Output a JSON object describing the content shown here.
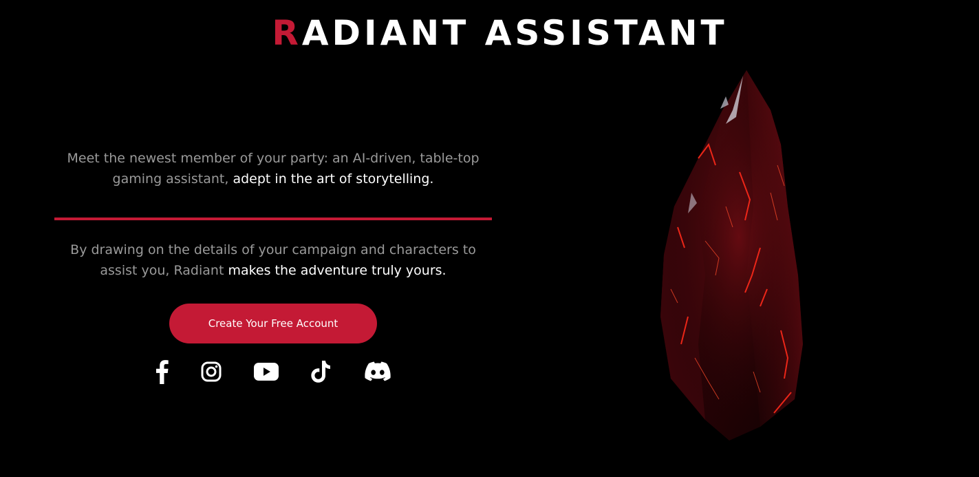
{
  "header": {
    "title_first_letter": "R",
    "title_rest": "ADIANT ASSISTANT"
  },
  "intro": {
    "muted": "Meet the newest member of your party: an AI-driven, table-top gaming assistant, ",
    "highlight": "adept in the art of storytelling."
  },
  "detail": {
    "muted": "By drawing on the details of your campaign and characters to assist you, Radiant ",
    "highlight": "makes the adventure truly yours."
  },
  "cta": {
    "label": "Create Your Free Account"
  },
  "social": [
    {
      "name": "facebook",
      "icon": "facebook-icon"
    },
    {
      "name": "instagram",
      "icon": "instagram-icon"
    },
    {
      "name": "youtube",
      "icon": "youtube-icon"
    },
    {
      "name": "tiktok",
      "icon": "tiktok-icon"
    },
    {
      "name": "discord",
      "icon": "discord-icon"
    }
  ],
  "hero": {
    "icon": "red-crystal-image"
  },
  "colors": {
    "background": "#000000",
    "accent": "#c41a35",
    "text_primary": "#ffffff",
    "text_muted": "#9a9a9a"
  }
}
